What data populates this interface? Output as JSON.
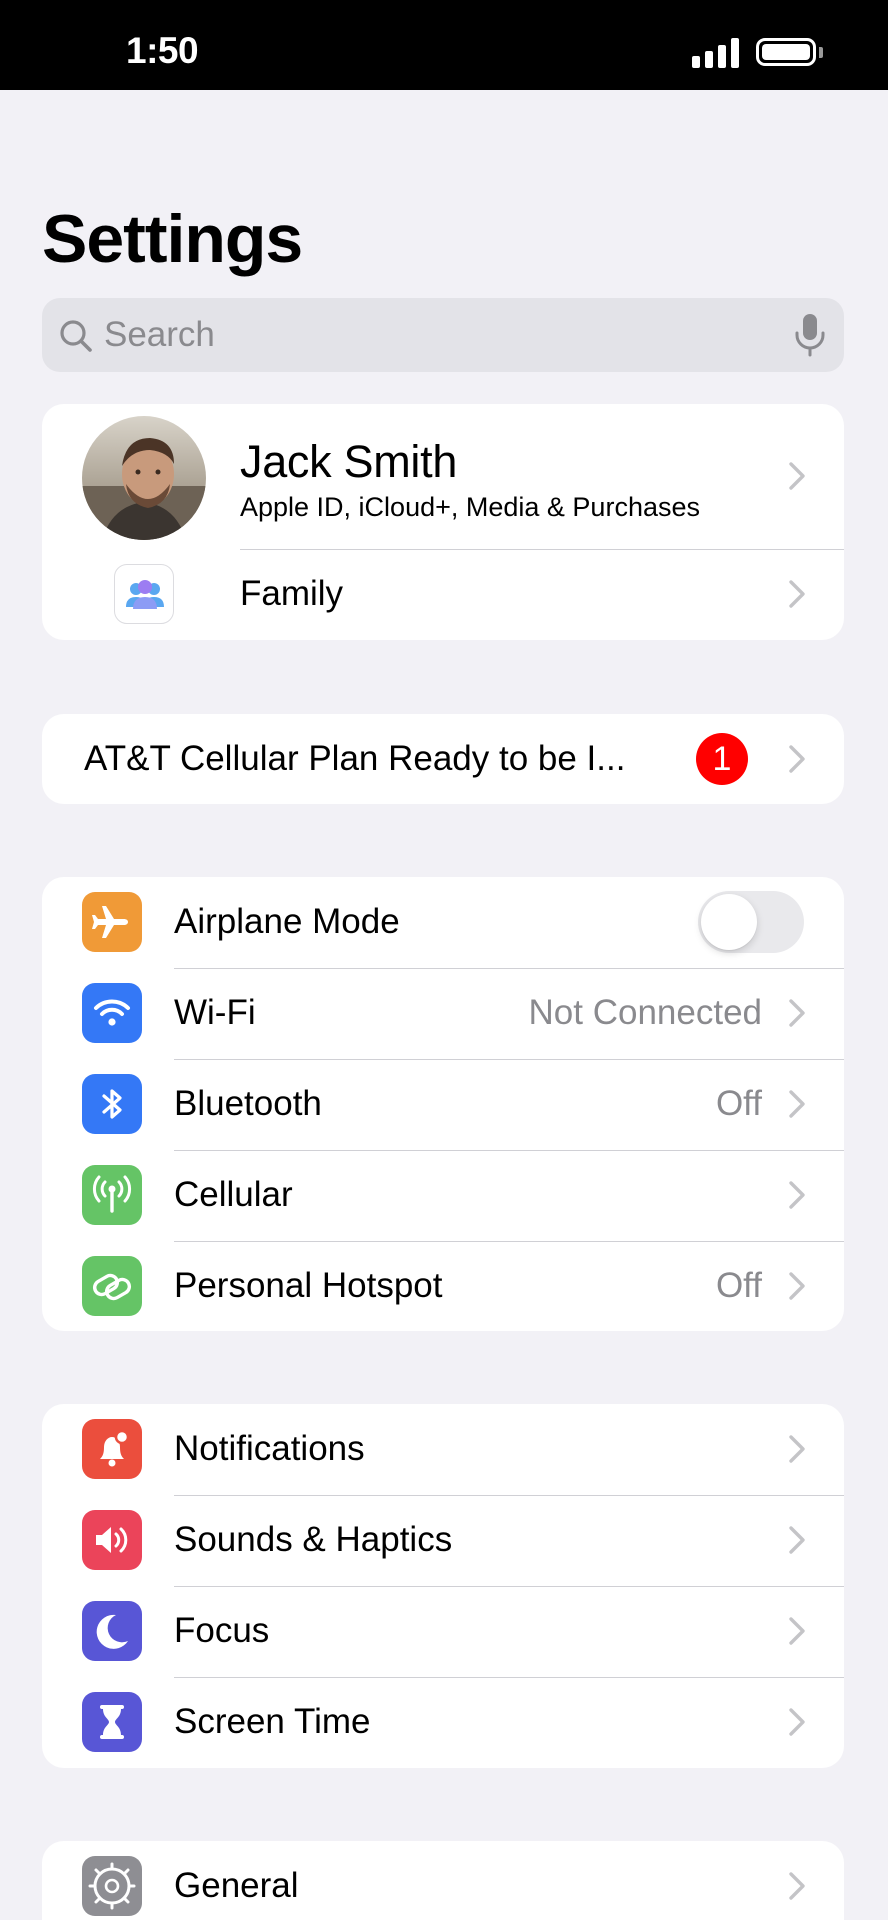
{
  "status_bar": {
    "time": "1:50"
  },
  "header": {
    "title": "Settings"
  },
  "search": {
    "placeholder": "Search"
  },
  "profile": {
    "name": "Jack Smith",
    "subtitle": "Apple ID, iCloud+, Media & Purchases",
    "family_label": "Family"
  },
  "alert": {
    "label": "AT&T Cellular Plan Ready to be I...",
    "badge": "1"
  },
  "connectivity": {
    "airplane_mode": {
      "label": "Airplane Mode",
      "on": false,
      "icon": "airplane-icon",
      "color": "#f09a37"
    },
    "wifi": {
      "label": "Wi-Fi",
      "value": "Not Connected",
      "icon": "wifi-icon",
      "color": "#3478f6"
    },
    "bluetooth": {
      "label": "Bluetooth",
      "value": "Off",
      "icon": "bluetooth-icon",
      "color": "#3478f6"
    },
    "cellular": {
      "label": "Cellular",
      "value": "",
      "icon": "cellular-antenna-icon",
      "color": "#65c466"
    },
    "hotspot": {
      "label": "Personal Hotspot",
      "value": "Off",
      "icon": "hotspot-icon",
      "color": "#65c466"
    }
  },
  "attention": {
    "notifications": {
      "label": "Notifications",
      "icon": "notifications-icon",
      "color": "#eb4e3d"
    },
    "sounds": {
      "label": "Sounds & Haptics",
      "icon": "speaker-icon",
      "color": "#eb445a"
    },
    "focus": {
      "label": "Focus",
      "icon": "moon-icon",
      "color": "#5856d6"
    },
    "screen_time": {
      "label": "Screen Time",
      "icon": "hourglass-icon",
      "color": "#5856d6"
    }
  },
  "general": {
    "general": {
      "label": "General",
      "icon": "gear-icon",
      "color": "#8e8e93"
    }
  }
}
